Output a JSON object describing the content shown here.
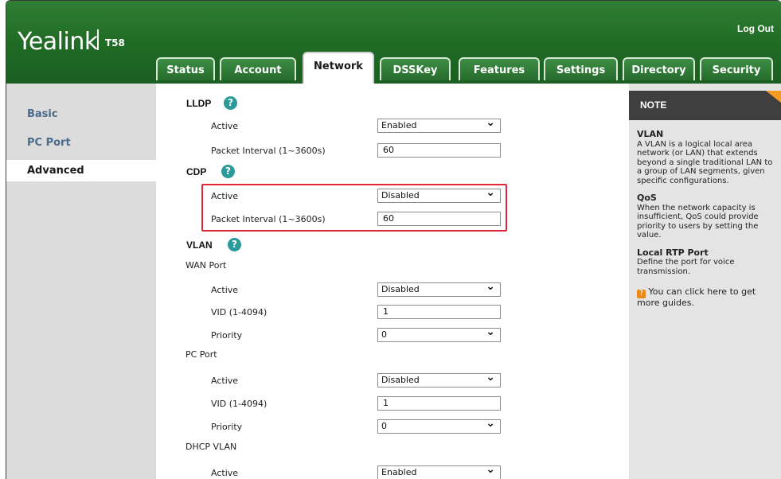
{
  "header": {
    "brand": "Yealink",
    "model": "T58",
    "logout": "Log Out"
  },
  "tabs": [
    {
      "label": "Status"
    },
    {
      "label": "Account"
    },
    {
      "label": "Network"
    },
    {
      "label": "DSSKey"
    },
    {
      "label": "Features"
    },
    {
      "label": "Settings"
    },
    {
      "label": "Directory"
    },
    {
      "label": "Security"
    }
  ],
  "active_tab": "Network",
  "sidebar": {
    "items": [
      {
        "label": "Basic"
      },
      {
        "label": "PC Port"
      },
      {
        "label": "Advanced"
      }
    ],
    "active": "Advanced"
  },
  "content": {
    "lldp": {
      "title": "LLDP",
      "active_label": "Active",
      "active_value": "Enabled",
      "interval_label": "Packet Interval (1~3600s)",
      "interval_value": "60"
    },
    "cdp": {
      "title": "CDP",
      "active_label": "Active",
      "active_value": "Disabled",
      "interval_label": "Packet Interval (1~3600s)",
      "interval_value": "60"
    },
    "vlan": {
      "title": "VLAN",
      "wan": {
        "label": "WAN Port",
        "active_label": "Active",
        "active_value": "Disabled",
        "vid_label": "VID (1-4094)",
        "vid_value": "1",
        "priority_label": "Priority",
        "priority_value": "0"
      },
      "pc": {
        "label": "PC Port",
        "active_label": "Active",
        "active_value": "Disabled",
        "vid_label": "VID (1-4094)",
        "vid_value": "1",
        "priority_label": "Priority",
        "priority_value": "0"
      },
      "dhcp": {
        "label": "DHCP VLAN",
        "active_label": "Active",
        "active_value": "Enabled"
      }
    }
  },
  "note": {
    "title": "NOTE",
    "vlan_title": "VLAN",
    "vlan_text": "A VLAN is a logical local area network (or LAN) that extends beyond a single traditional LAN to a group of LAN segments, given specific configurations.",
    "qos_title": "QoS",
    "qos_text": "When the network capacity is insufficient, QoS could provide priority to users by setting the value.",
    "rtp_title": "Local RTP Port",
    "rtp_text": "Define the port for voice transmission.",
    "guide_text": "You can click here to get more guides."
  },
  "colors": {
    "header_green": "#1f6a25",
    "highlight_red": "#e0283c",
    "help_icon": "#2a9a9a",
    "note_corner": "#f39a21"
  },
  "icons": {
    "help": "question-circle-icon",
    "dropdown": "chevron-down-icon",
    "guide": "guide-book-icon"
  }
}
